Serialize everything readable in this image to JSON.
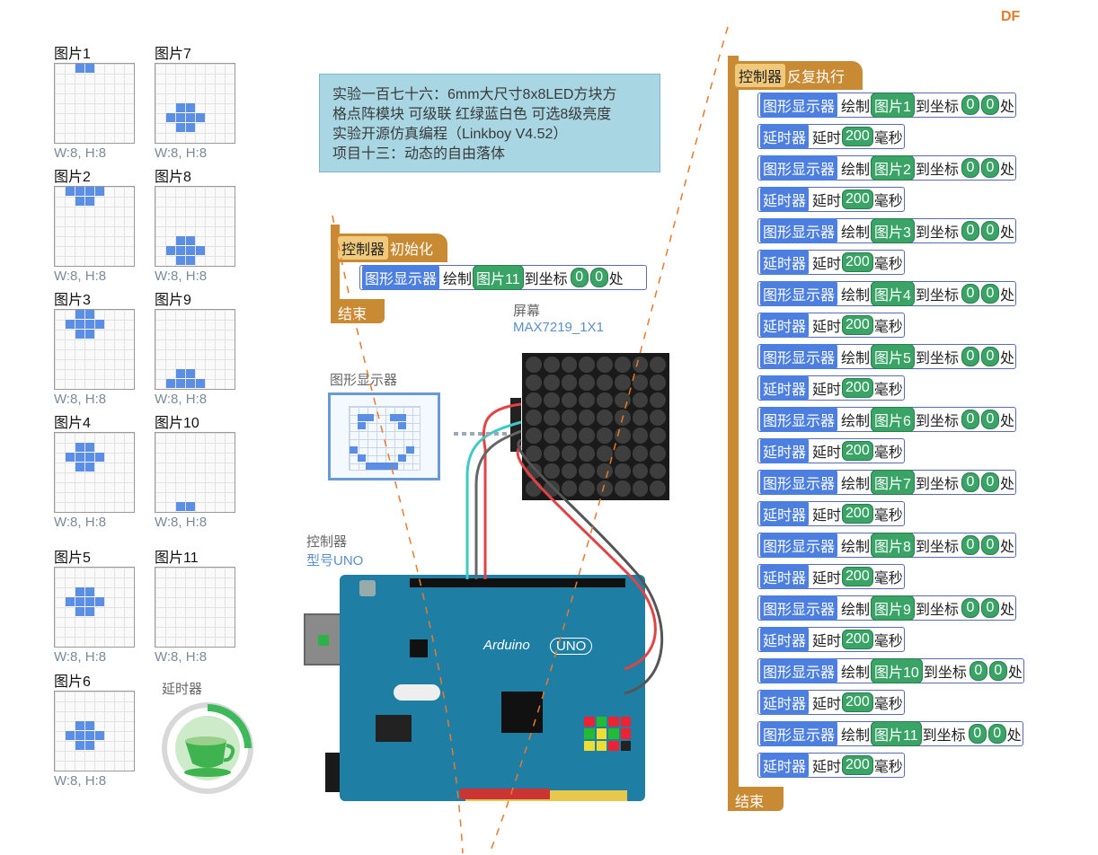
{
  "logo": "DF",
  "pictures": [
    {
      "label": "图片1",
      "size": "W:8, H:8"
    },
    {
      "label": "图片2",
      "size": "W:8, H:8"
    },
    {
      "label": "图片3",
      "size": "W:8, H:8"
    },
    {
      "label": "图片4",
      "size": "W:8, H:8"
    },
    {
      "label": "图片5",
      "size": "W:8, H:8"
    },
    {
      "label": "图片6",
      "size": "W:8, H:8"
    },
    {
      "label": "图片7",
      "size": "W:8, H:8"
    },
    {
      "label": "图片8",
      "size": "W:8, H:8"
    },
    {
      "label": "图片9",
      "size": "W:8, H:8"
    },
    {
      "label": "图片10",
      "size": "W:8, H:8"
    },
    {
      "label": "图片11",
      "size": "W:8, H:8"
    }
  ],
  "delay_module": {
    "label": "延时器",
    "icon": "teacup-icon"
  },
  "note": {
    "line1": "实验一百七十六：6mm大尺寸8x8LED方块方",
    "line2": "格点阵模块 可级联 红绿蓝白色 可选8级亮度",
    "line3": "实验开源仿真编程（Linkboy V4.52）",
    "line4": "项目十三：动态的自由落体"
  },
  "init_block": {
    "module": "控制器",
    "title": "初始化",
    "stmt": {
      "module": "图形显示器",
      "action": "绘制",
      "image": "图片11",
      "to": "到坐标",
      "x": "0",
      "y": "0",
      "suffix": "处"
    },
    "end": "结束"
  },
  "screen": {
    "label": "屏幕",
    "model": "MAX7219_1X1"
  },
  "graphic_display": {
    "label": "图形显示器"
  },
  "controller": {
    "label": "控制器",
    "model": "型号UNO",
    "board_text": "Arduino",
    "board_model": "UNO"
  },
  "loop_block": {
    "module": "控制器",
    "title": "反复执行",
    "end": "结束",
    "draw": {
      "module": "图形显示器",
      "action": "绘制",
      "to": "到坐标",
      "x": "0",
      "y": "0",
      "suffix": "处"
    },
    "delay": {
      "module": "延时器",
      "action": "延时",
      "value": "200",
      "unit": "毫秒"
    },
    "images": [
      "图片1",
      "图片2",
      "图片3",
      "图片4",
      "图片5",
      "图片6",
      "图片7",
      "图片8",
      "图片9",
      "图片10",
      "图片11"
    ]
  },
  "colors": {
    "hat": "#c98a34",
    "module": "#4c7fe0",
    "value": "#3aa366",
    "pixel": "#5b8fe6"
  }
}
